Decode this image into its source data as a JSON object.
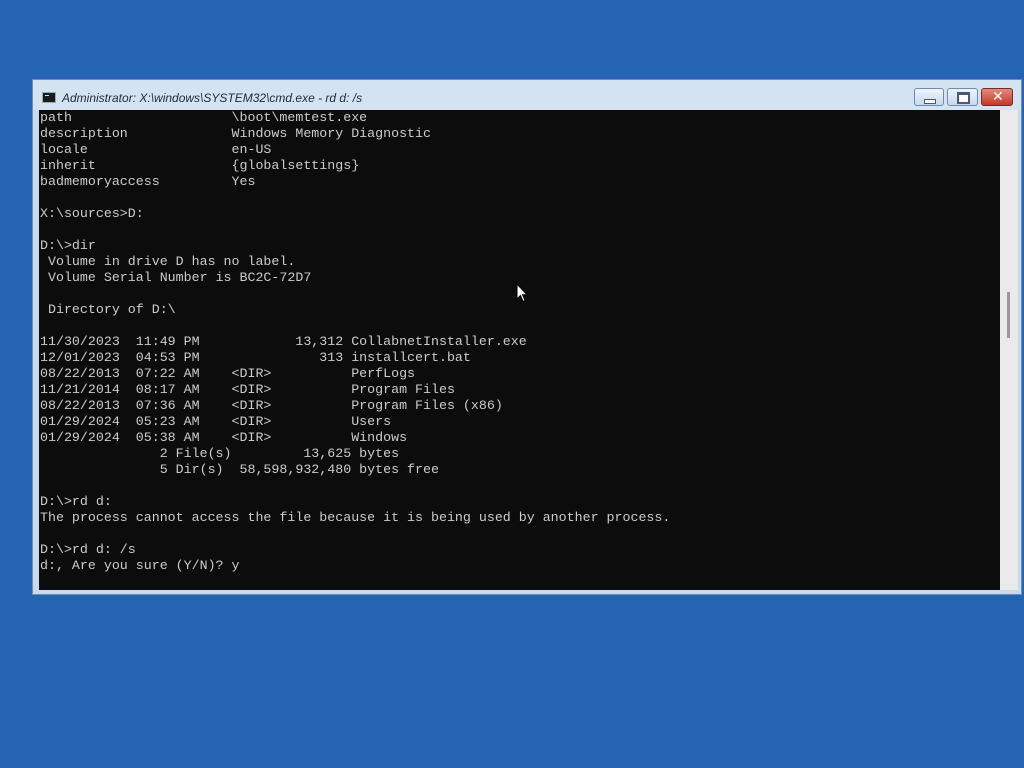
{
  "window": {
    "title": "Administrator: X:\\windows\\SYSTEM32\\cmd.exe - rd  d: /s",
    "controls": {
      "minimize": "minimize-icon",
      "maximize": "maximize-icon",
      "close": "✕"
    }
  },
  "console": {
    "lines": [
      "path                    \\boot\\memtest.exe",
      "description             Windows Memory Diagnostic",
      "locale                  en-US",
      "inherit                 {globalsettings}",
      "badmemoryaccess         Yes",
      "",
      "X:\\sources>D:",
      "",
      "D:\\>dir",
      " Volume in drive D has no label.",
      " Volume Serial Number is BC2C-72D7",
      "",
      " Directory of D:\\",
      "",
      "11/30/2023  11:49 PM            13,312 CollabnetInstaller.exe",
      "12/01/2023  04:53 PM               313 installcert.bat",
      "08/22/2013  07:22 AM    <DIR>          PerfLogs",
      "11/21/2014  08:17 AM    <DIR>          Program Files",
      "08/22/2013  07:36 AM    <DIR>          Program Files (x86)",
      "01/29/2024  05:23 AM    <DIR>          Users",
      "01/29/2024  05:38 AM    <DIR>          Windows",
      "               2 File(s)         13,625 bytes",
      "               5 Dir(s)  58,598,932,480 bytes free",
      "",
      "D:\\>rd d:",
      "The process cannot access the file because it is being used by another process.",
      "",
      "D:\\>rd d: /s",
      "d:, Are you sure (Y/N)? y"
    ]
  },
  "colors": {
    "desktop": "#2563b3",
    "console_bg": "#0c0c0c",
    "console_text": "#cccccc"
  }
}
